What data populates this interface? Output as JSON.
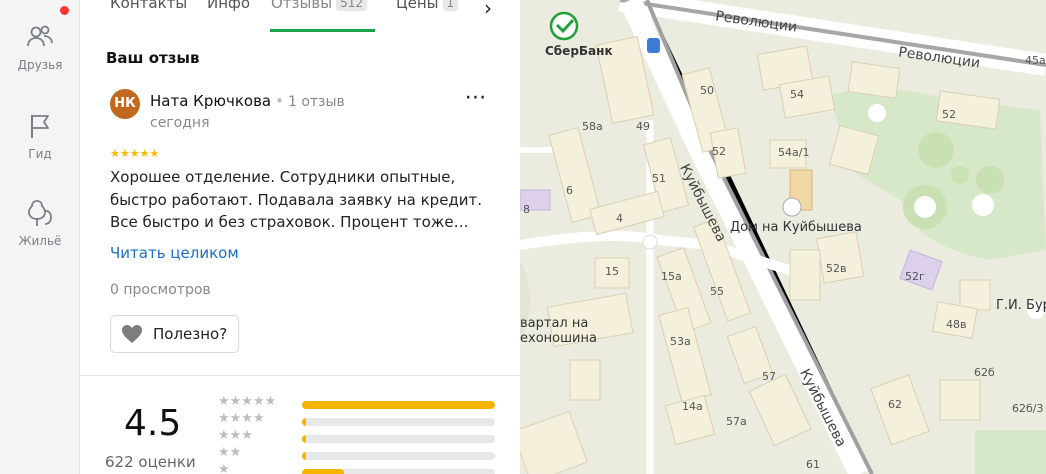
{
  "rail": {
    "items": [
      {
        "label": "Друзья",
        "icon": "friends-icon"
      },
      {
        "label": "Гид",
        "icon": "flag-icon"
      },
      {
        "label": "Жильё",
        "icon": "housing-icon"
      }
    ],
    "notification_color": "#ff3333"
  },
  "tabs": [
    {
      "label": "Контакты"
    },
    {
      "label": "Инфо"
    },
    {
      "label": "Отзывы",
      "count": "512",
      "active": true
    },
    {
      "label": "Цены",
      "count": "1"
    }
  ],
  "your_review": {
    "title": "Ваш отзыв",
    "author_initials": "НК",
    "author_name": "Ната Крючкова",
    "author_reviews": "1 отзыв",
    "date": "сегодня",
    "stars": "★★★★★",
    "text": "Хорошее отделение. Сотрудники опытные, быстро работают. Подавала заявку на кредит. Все быстро и без страховок. Процент тоже…",
    "read_more": "Читать целиком",
    "views": "0 просмотров",
    "useful_label": "Полезно?"
  },
  "rating": {
    "value": "4.5",
    "count_label": "622 оценки",
    "distribution": [
      {
        "stars": "★★★★★",
        "fraction": 1.0
      },
      {
        "stars": "★★★★",
        "fraction": 0.02
      },
      {
        "stars": "★★★",
        "fraction": 0.02
      },
      {
        "stars": "★★",
        "fraction": 0.02
      },
      {
        "stars": "★",
        "fraction": 0.22
      }
    ]
  },
  "map": {
    "bank_name": "СберБанк",
    "streets": [
      "Революции",
      "Революции",
      "Куйбышева",
      "Куйбышева"
    ],
    "poi": [
      "Дом на Куйбышева",
      "Г.И. Бур",
      "вартал на",
      "ехоношина"
    ],
    "house_numbers": [
      "50",
      "54",
      "52",
      "58а",
      "49",
      "52",
      "54а/1",
      "51",
      "6",
      "4",
      "8",
      "15",
      "15а",
      "55",
      "52в",
      "52г",
      "48в",
      "53а",
      "57",
      "14а",
      "57а",
      "62",
      "62б",
      "62б/3",
      "61",
      "45а"
    ],
    "brand_color": "#21a038"
  },
  "colors": {
    "accent_green": "#1aa34a",
    "link_blue": "#1a6dc9",
    "star_yellow": "#ffb800",
    "avatar_bg": "#c2681c"
  }
}
